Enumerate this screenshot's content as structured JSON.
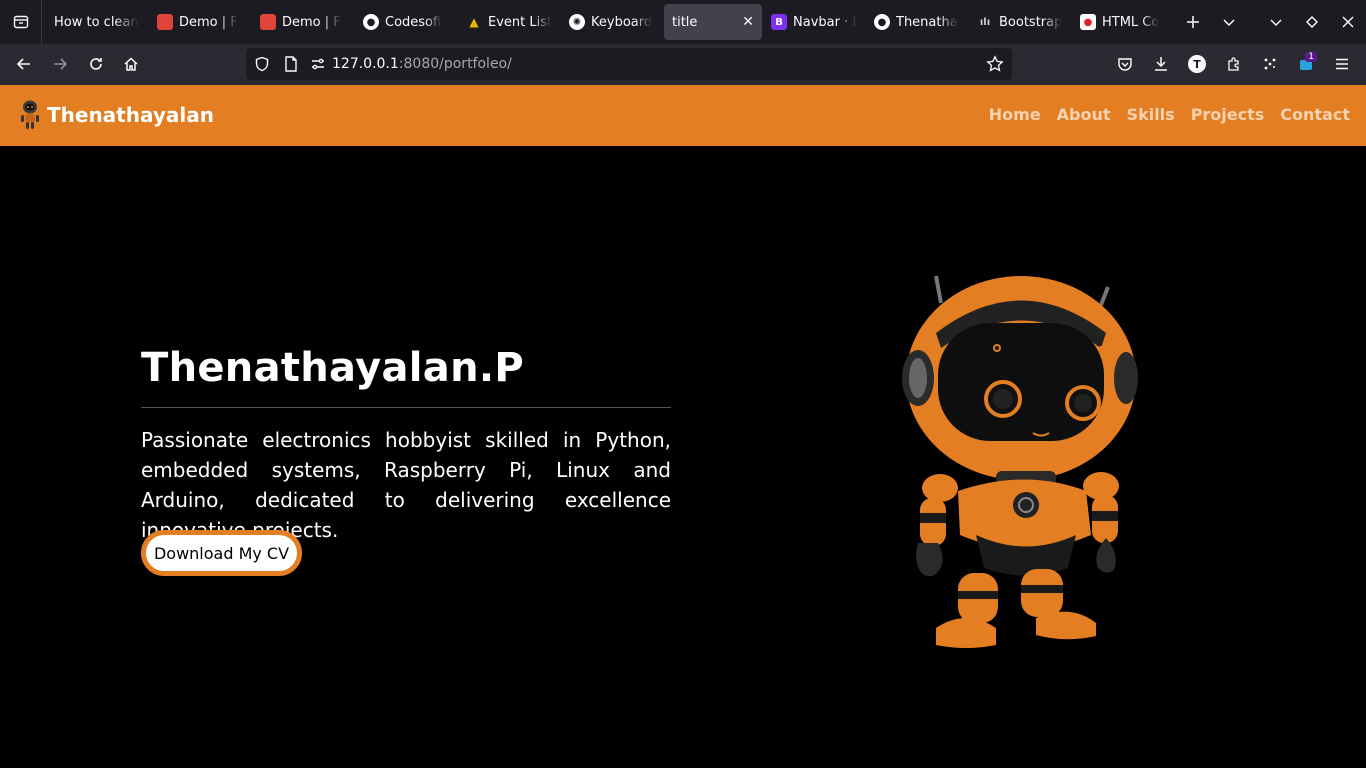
{
  "browser": {
    "tabs": [
      {
        "title": "How to clean",
        "favicon": "blank"
      },
      {
        "title": "Demo | F",
        "favicon": "red-square"
      },
      {
        "title": "Demo | F",
        "favicon": "red-square"
      },
      {
        "title": "Codesoft",
        "favicon": "github"
      },
      {
        "title": "Event List",
        "favicon": "dark-crown"
      },
      {
        "title": "Keyboard",
        "favicon": "openai"
      },
      {
        "title": "title",
        "favicon": "none",
        "active": true
      },
      {
        "title": "Navbar · B",
        "favicon": "bootstrap"
      },
      {
        "title": "Thenatha",
        "favicon": "github"
      },
      {
        "title": "Bootstrap",
        "favicon": "wave"
      },
      {
        "title": "HTML Co",
        "favicon": "red-circle"
      }
    ],
    "url_host": "127.0.0.1",
    "url_rest": ":8080/portfoleo/",
    "extension_badge": "1",
    "account_initial": "T"
  },
  "site": {
    "brand": "Thenathayalan",
    "nav": [
      "Home",
      "About",
      "Skills",
      "Projects",
      "Contact"
    ],
    "hero_name": "Thenathayalan.P",
    "hero_description": "Passionate electronics hobbyist skilled in Python, embedded systems, Raspberry Pi, Linux and Arduino, dedicated to delivering excellence innovative projects.",
    "cv_button": "Download My CV"
  },
  "colors": {
    "accent": "#e47e22",
    "background": "#000000",
    "chrome_dark": "#1c1b22",
    "chrome_mid": "#2b2a33"
  }
}
